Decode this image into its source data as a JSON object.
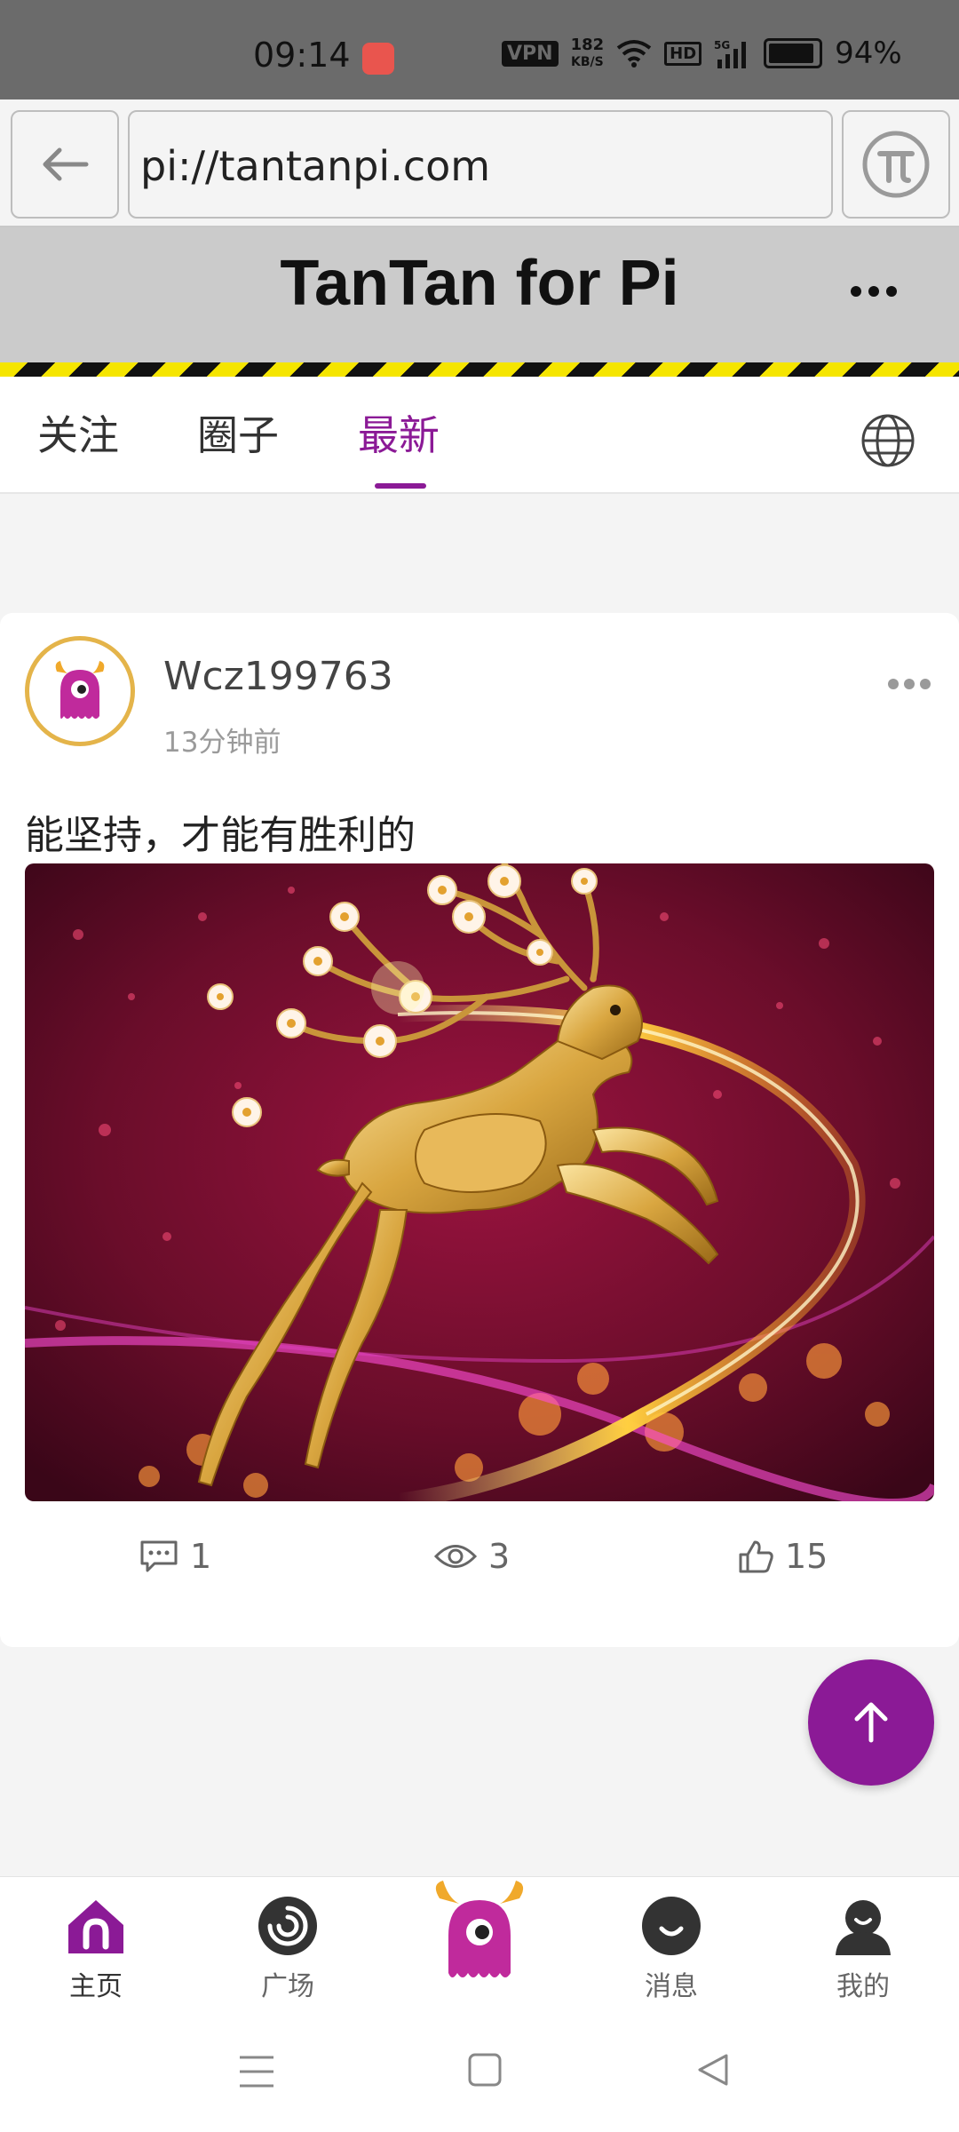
{
  "status_bar": {
    "time": "09:14",
    "vpn": "VPN",
    "speed_value": "182",
    "speed_unit": "KB/S",
    "hd": "HD",
    "network": "5G",
    "battery": "94%"
  },
  "browser": {
    "url": "pi://tantanpi.com"
  },
  "header": {
    "title": "TanTan for Pi"
  },
  "tabs": [
    {
      "label": "关注",
      "active": false
    },
    {
      "label": "圈子",
      "active": false
    },
    {
      "label": "最新",
      "active": true
    }
  ],
  "post": {
    "username": "Wcz199763",
    "time_ago": "13分钟前",
    "text": "能坚持，才能有胜利的",
    "comments": "1",
    "views": "3",
    "likes": "15"
  },
  "bottom_nav": [
    {
      "label": "主页",
      "icon": "home-icon",
      "active": true
    },
    {
      "label": "广场",
      "icon": "square-icon",
      "active": false
    },
    {
      "label": "",
      "icon": "mascot-icon",
      "active": false
    },
    {
      "label": "消息",
      "icon": "message-icon",
      "active": false
    },
    {
      "label": "我的",
      "icon": "profile-icon",
      "active": false
    }
  ],
  "colors": {
    "accent": "#8b1a96",
    "header_bg": "#cbcbcb",
    "hazard_yellow": "#f5e500"
  }
}
